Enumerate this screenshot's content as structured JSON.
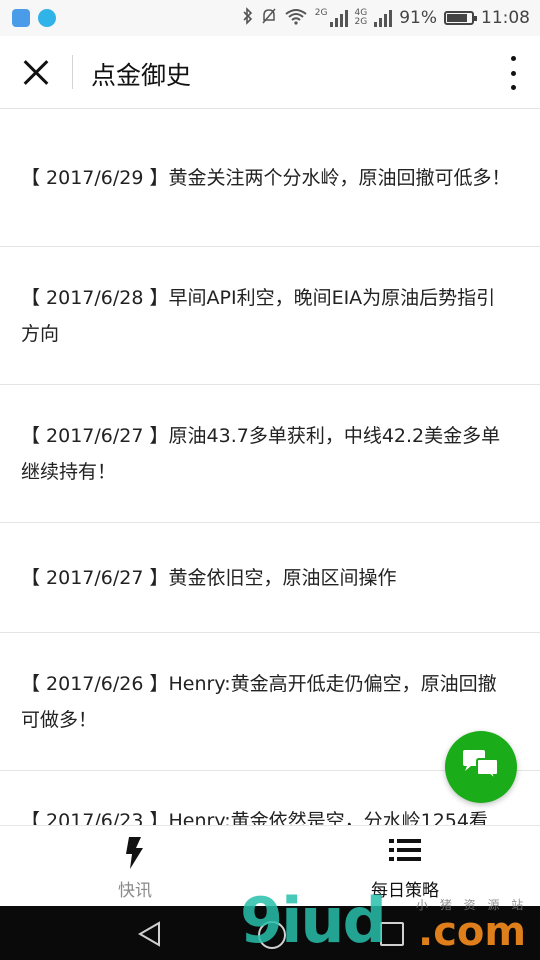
{
  "status_bar": {
    "battery": "91%",
    "time": "11:08",
    "net_top": "4G",
    "net_bottom": "2G",
    "wifi_gen": "2G",
    "battery_level": 0.91,
    "icons": [
      "gallery-icon",
      "chat-notification-icon",
      "bluetooth-icon",
      "mute-icon",
      "wifi-icon",
      "signal-icon",
      "battery-icon"
    ]
  },
  "header": {
    "title": "点金御史",
    "close_icon": "close-icon",
    "more_icon": "more-vertical-icon"
  },
  "articles": [
    {
      "date": "【 2017/6/29 】",
      "title": "黄金关注两个分水岭，原油回撤可低多！"
    },
    {
      "date": "【 2017/6/28 】",
      "title": "早间API利空，晚间EIA为原油后势指引方向"
    },
    {
      "date": "【 2017/6/27 】",
      "title": "原油43.7多单获利，中线42.2美金多单继续持有！"
    },
    {
      "date": "【 2017/6/27 】",
      "title": "黄金依旧空，原油区间操作"
    },
    {
      "date": "【 2017/6/26 】",
      "title": "Henry:黄金高开低走仍偏空，原油回撤可做多！"
    },
    {
      "date": "【 2017/6/23 】",
      "title": "Henry:黄金依然是空，分水岭1254看"
    }
  ],
  "tabs": [
    {
      "label": "快讯",
      "icon": "lightning-icon",
      "active": false
    },
    {
      "label": "每日策略",
      "icon": "list-icon",
      "active": true
    }
  ],
  "fab": {
    "icon": "chat-bubbles-icon"
  },
  "watermark": {
    "main": "9iud",
    "domain": ".com",
    "small": "小 猪 资 源 站"
  },
  "colors": {
    "accent": "#1aad19",
    "divider": "#e4e4e4",
    "inactive_tab": "#8a8a8a"
  }
}
